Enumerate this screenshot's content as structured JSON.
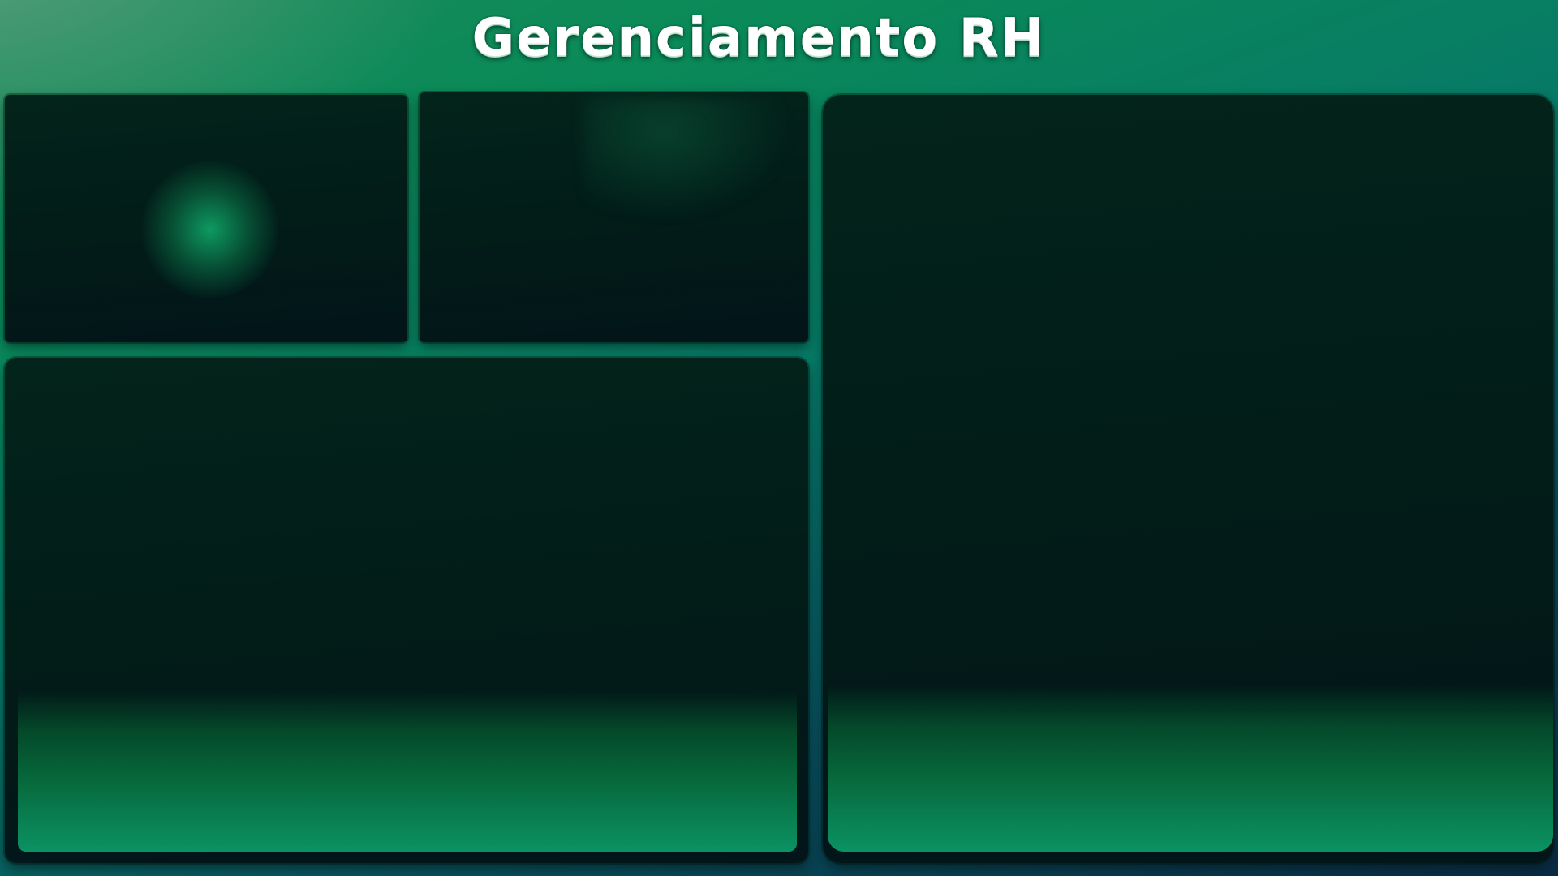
{
  "header": {
    "title": "Gerenciamento RH"
  },
  "panels": [
    {
      "id": "panel-a",
      "content": ""
    },
    {
      "id": "panel-b",
      "content": ""
    },
    {
      "id": "panel-c",
      "content": ""
    },
    {
      "id": "panel-d",
      "content": ""
    }
  ],
  "colors": {
    "background_primary": "#0a8a58",
    "background_secondary": "#0a2a44",
    "panel_background": "#021d18",
    "accent_glow": "#0b9263",
    "title_text": "#ffffff"
  }
}
